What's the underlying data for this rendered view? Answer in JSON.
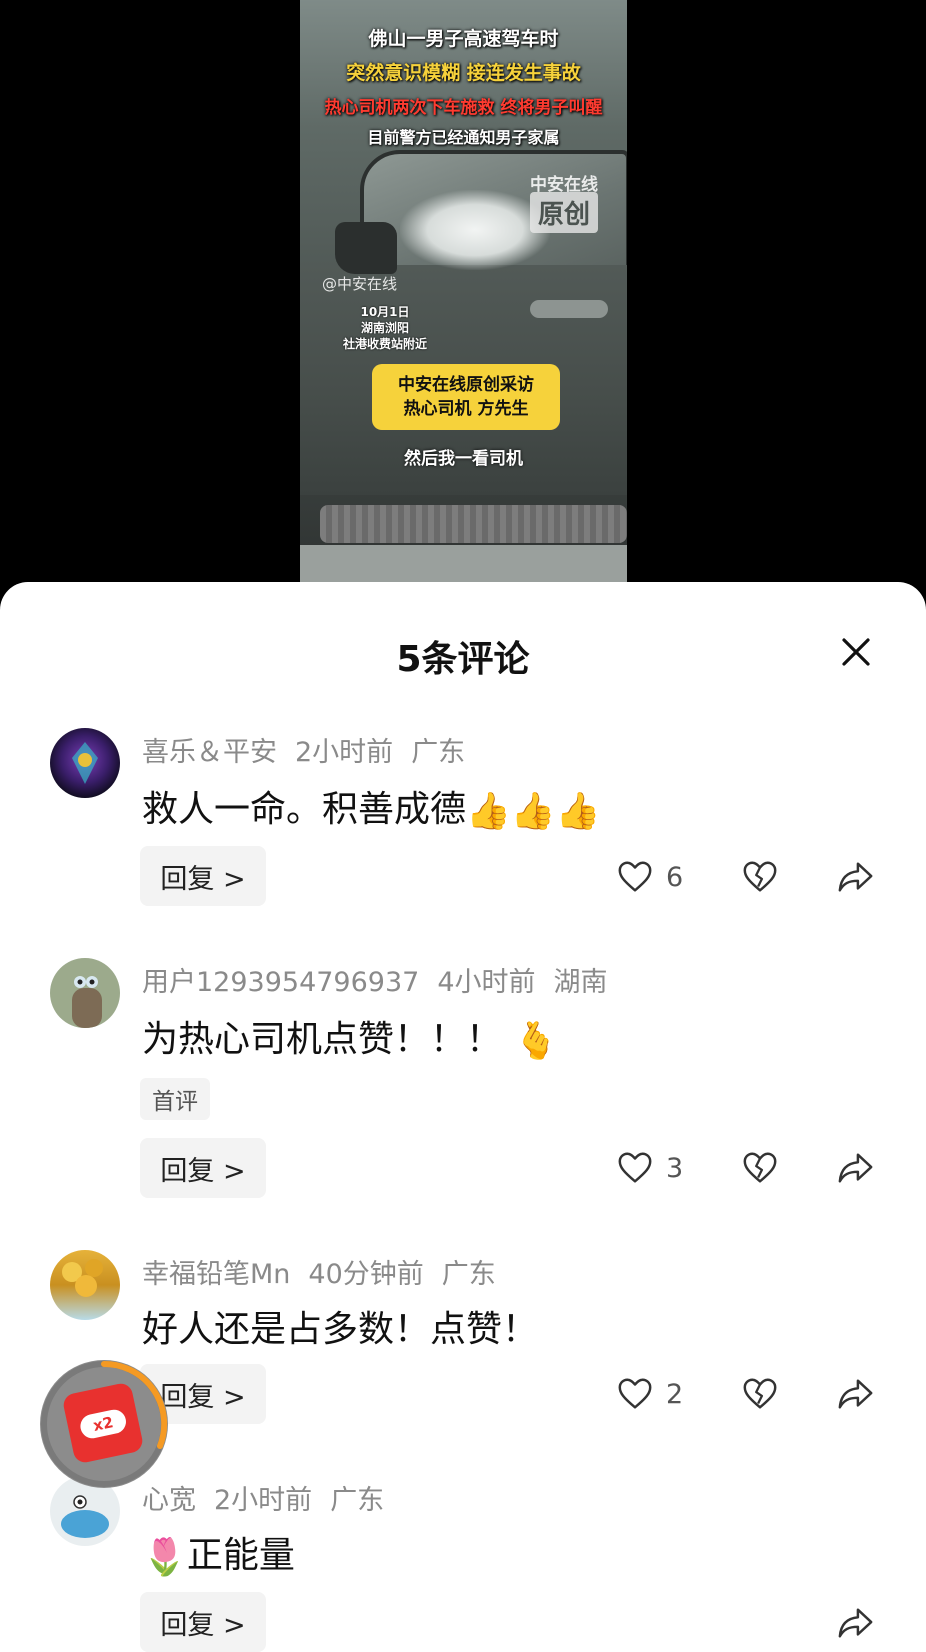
{
  "video": {
    "caption_line1": "佛山一男子高速驾车时",
    "caption_line2": "突然意识模糊 接连发生事故",
    "caption_line3": "热心司机两次下车施救 终将男子叫醒",
    "caption_line4": "目前警方已经通知男子家属",
    "watermark_name": "中安在线",
    "watermark_label": "原创",
    "watermark_handle": "@中安在线",
    "date_line1": "10月1日",
    "date_line2": "湖南浏阳",
    "date_line3": "社港收费站附近",
    "interview_line1": "中安在线原创采访",
    "interview_line2": "热心司机 方先生",
    "subtitle": "然后我一看司机"
  },
  "comments_sheet": {
    "title": "5条评论",
    "comments": [
      {
        "username": "喜乐＆平安",
        "time": "2小时前",
        "location": "广东",
        "text": "救人一命。积善成德",
        "emoji": "👍👍👍",
        "reply_label": "回复 >",
        "likes": "6"
      },
      {
        "username": "用户1293954796937",
        "time": "4小时前",
        "location": "湖南",
        "text": "为热心司机点赞！！！",
        "emoji": "🫰",
        "tag": "首评",
        "reply_label": "回复 >",
        "likes": "3"
      },
      {
        "username": "幸福铅笔Mn",
        "time": "40分钟前",
        "location": "广东",
        "text": "好人还是占多数！点赞！",
        "reply_label": "回复 >",
        "likes": "2"
      },
      {
        "username": "心宽",
        "time": "2小时前",
        "location": "广东",
        "emoji": "🌷",
        "text": "正能量",
        "reply_label": "回复 >"
      }
    ]
  },
  "floating_badge": {
    "label": "x2",
    "icon": "red-envelope-icon"
  },
  "icons": {
    "like": "heart-outline-icon",
    "dislike": "broken-heart-icon",
    "share": "share-arrow-icon",
    "close": "close-icon"
  }
}
